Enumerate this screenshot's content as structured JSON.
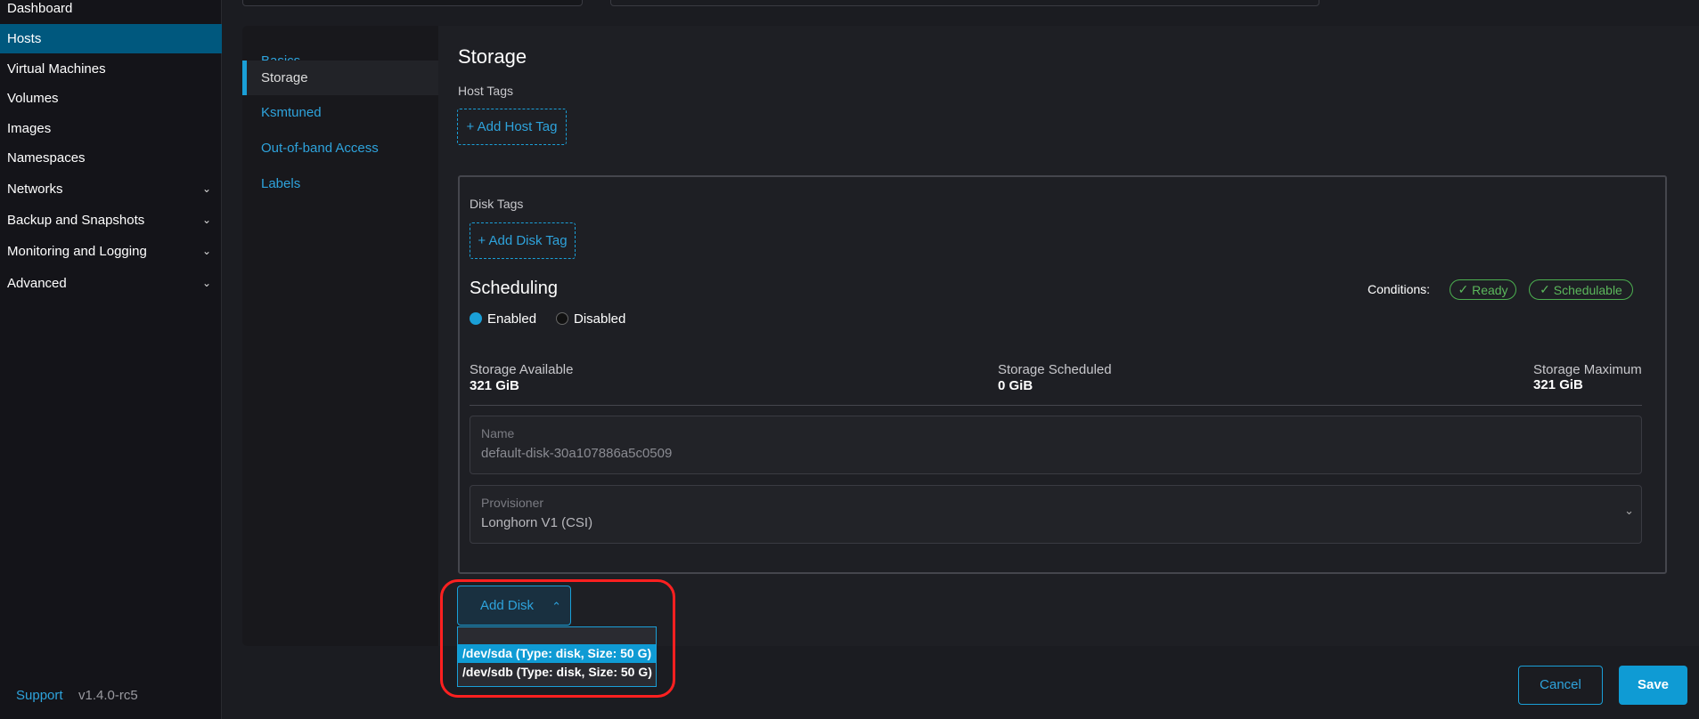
{
  "sidebar": {
    "items": [
      {
        "label": "Dashboard",
        "active": false,
        "expandable": false
      },
      {
        "label": "Hosts",
        "active": true,
        "expandable": false
      },
      {
        "label": "Virtual Machines",
        "active": false,
        "expandable": false
      },
      {
        "label": "Volumes",
        "active": false,
        "expandable": false
      },
      {
        "label": "Images",
        "active": false,
        "expandable": false
      },
      {
        "label": "Namespaces",
        "active": false,
        "expandable": false
      },
      {
        "label": "Networks",
        "active": false,
        "expandable": true
      },
      {
        "label": "Backup and Snapshots",
        "active": false,
        "expandable": true
      },
      {
        "label": "Monitoring and Logging",
        "active": false,
        "expandable": true
      },
      {
        "label": "Advanced",
        "active": false,
        "expandable": true
      }
    ],
    "support": "Support",
    "version": "v1.4.0-rc5"
  },
  "tabs": [
    {
      "label": "Basics"
    },
    {
      "label": "Storage",
      "active": true
    },
    {
      "label": "Ksmtuned"
    },
    {
      "label": "Out-of-band Access"
    },
    {
      "label": "Labels"
    }
  ],
  "storage": {
    "title": "Storage",
    "host_tags_label": "Host Tags",
    "add_host_tag": "+ Add Host Tag",
    "disk": {
      "disk_tags_label": "Disk Tags",
      "add_disk_tag": "+ Add Disk Tag",
      "scheduling_title": "Scheduling",
      "conditions_label": "Conditions:",
      "conditions": [
        "Ready",
        "Schedulable"
      ],
      "enabled": "Enabled",
      "disabled": "Disabled",
      "scheduling_value": "Enabled",
      "available_label": "Storage Available",
      "available": "321 GiB",
      "scheduled_label": "Storage Scheduled",
      "scheduled": "0 GiB",
      "maximum_label": "Storage Maximum",
      "maximum": "321 GiB",
      "name_label": "Name",
      "name_value": "default-disk-30a107886a5c0509",
      "provisioner_label": "Provisioner",
      "provisioner_value": "Longhorn V1 (CSI)"
    },
    "add_disk": "Add Disk",
    "disk_options": [
      "/dev/sda (Type: disk, Size: 50 G)",
      "/dev/sdb (Type: disk, Size: 50 G)"
    ],
    "highlighted_option": 0
  },
  "footer": {
    "cancel": "Cancel",
    "save": "Save"
  },
  "colors": {
    "accent": "#1a9fd7",
    "highlight": "#ff2020",
    "success": "#4caf50"
  }
}
